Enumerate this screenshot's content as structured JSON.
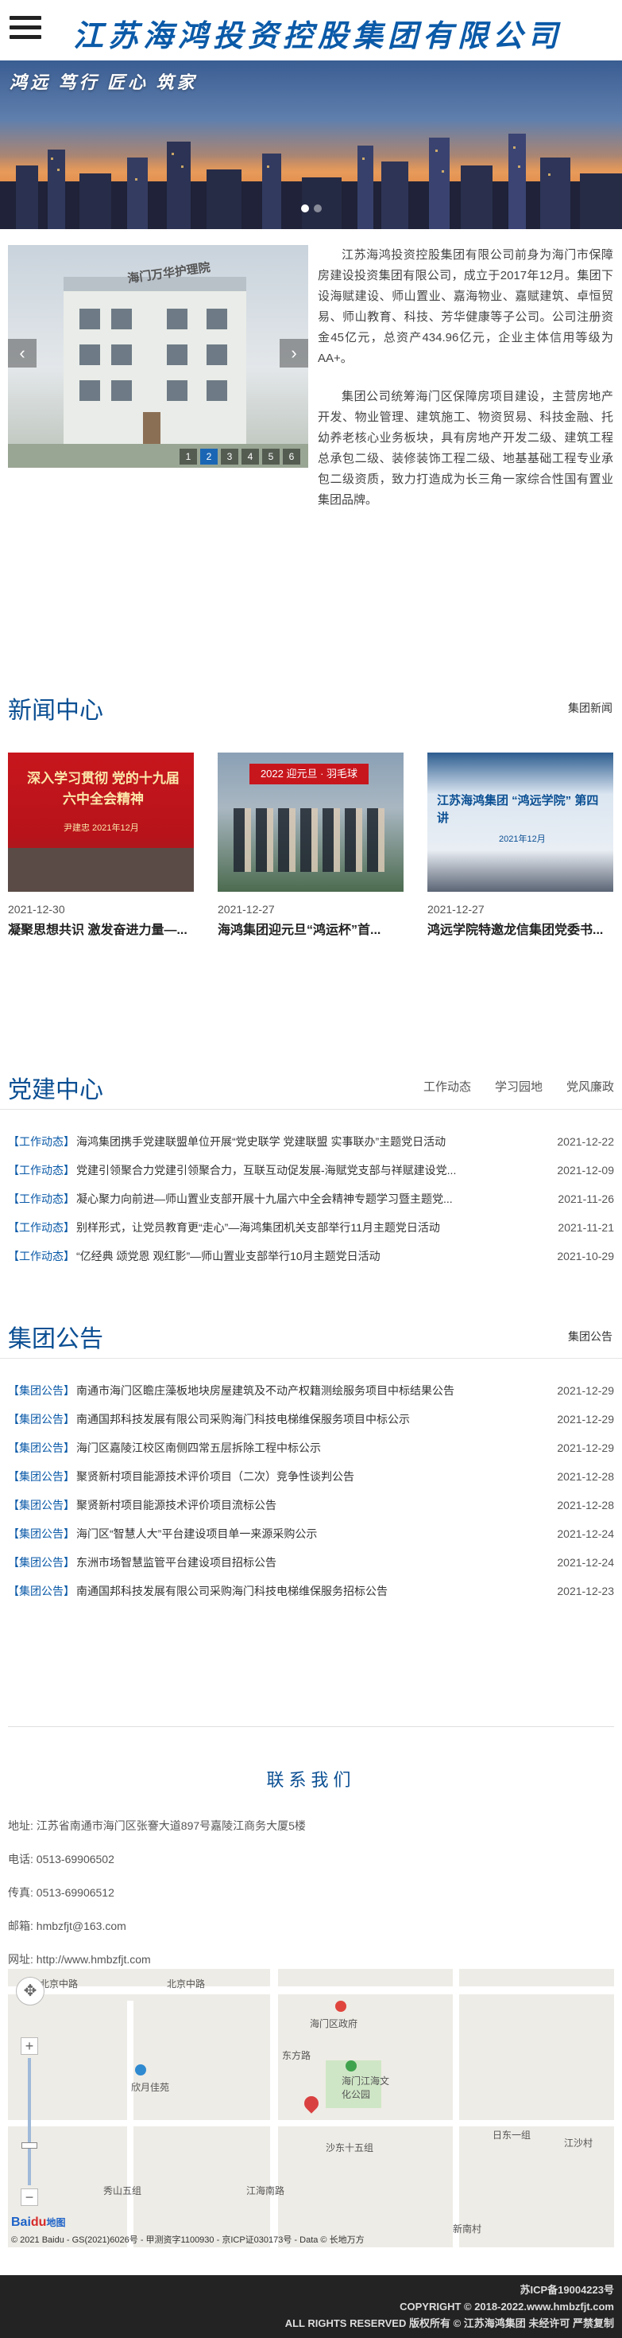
{
  "header": {
    "title": "江苏海鸿投资控股集团有限公司",
    "menu_icon": "menu-icon"
  },
  "banner": {
    "slogan": "鸿远 笃行 匠心 筑家",
    "dots": 2,
    "active_dot": 0
  },
  "about": {
    "slide_label": "海门万华护理院",
    "pager": [
      "1",
      "2",
      "3",
      "4",
      "5",
      "6"
    ],
    "active_page": 1,
    "prev_icon": "chevron-left-icon",
    "next_icon": "chevron-right-icon",
    "paragraphs": [
      "江苏海鸿投资控股集团有限公司前身为海门市保障房建设投资集团有限公司，成立于2017年12月。集团下设海赋建设、师山置业、嘉海物业、嘉赋建筑、卓恒贸易、师山教育、科技、芳华健康等子公司。公司注册资金45亿元，总资产434.96亿元，企业主体信用等级为AA+。",
      "集团公司统筹海门区保障房项目建设，主营房地产开发、物业管理、建筑施工、物资贸易、科技金融、托幼养老核心业务板块，具有房地产开发二级、建筑工程总承包二级、装修装饰工程二级、地基基础工程专业承包二级资质，致力打造成为长三角一家综合性国有置业集团品牌。"
    ]
  },
  "news": {
    "title": "新闻中心",
    "more": "集团新闻",
    "items": [
      {
        "date": "2021-12-30",
        "title": "凝聚思想共识 激发奋进力量—...",
        "thumb_text": "深入学习贯彻 党的十九届六中全会精神",
        "thumb_sub": "尹建忠 2021年12月"
      },
      {
        "date": "2021-12-27",
        "title": "海鸿集团迎元旦“鸿运杯”首...",
        "thumb_text": "2022 迎元旦 · 羽毛球"
      },
      {
        "date": "2021-12-27",
        "title": "鸿远学院特邀龙信集团党委书...",
        "thumb_text": "江苏海鸿集团 “鸿远学院” 第四讲",
        "thumb_sub": "2021年12月"
      }
    ]
  },
  "party": {
    "title": "党建中心",
    "tabs": [
      "工作动态",
      "学习园地",
      "党风廉政"
    ],
    "items": [
      {
        "cat": "【工作动态】",
        "text": "海鸿集团携手党建联盟单位开展“党史联学 党建联盟 实事联办”主题党日活动",
        "date": "2021-12-22"
      },
      {
        "cat": "【工作动态】",
        "text": "党建引领聚合力党建引领聚合力，互联互动促发展-海赋党支部与祥赋建设党...",
        "date": "2021-12-09"
      },
      {
        "cat": "【工作动态】",
        "text": "凝心聚力向前进—师山置业支部开展十九届六中全会精神专题学习暨主题党...",
        "date": "2021-11-26"
      },
      {
        "cat": "【工作动态】",
        "text": "别样形式，让党员教育更“走心”—海鸿集团机关支部举行11月主题党日活动",
        "date": "2021-11-21"
      },
      {
        "cat": "【工作动态】",
        "text": "“亿经典 颂党恩 观红影”—师山置业支部举行10月主题党日活动",
        "date": "2021-10-29"
      }
    ]
  },
  "notice": {
    "title": "集团公告",
    "more": "集团公告",
    "items": [
      {
        "cat": "【集团公告】",
        "text": "南通市海门区瞻庄藻板地块房屋建筑及不动产权籍测绘服务项目中标结果公告",
        "date": "2021-12-29"
      },
      {
        "cat": "【集团公告】",
        "text": "南通国邦科技发展有限公司采购海门科技电梯维保服务项目中标公示",
        "date": "2021-12-29"
      },
      {
        "cat": "【集团公告】",
        "text": "海门区嘉陵江校区南侧四常五层拆除工程中标公示",
        "date": "2021-12-29"
      },
      {
        "cat": "【集团公告】",
        "text": "聚贤新村项目能源技术评价项目（二次）竞争性谈判公告",
        "date": "2021-12-28"
      },
      {
        "cat": "【集团公告】",
        "text": "聚贤新村项目能源技术评价项目流标公告",
        "date": "2021-12-28"
      },
      {
        "cat": "【集团公告】",
        "text": "海门区“智慧人大”平台建设项目单一来源采购公示",
        "date": "2021-12-24"
      },
      {
        "cat": "【集团公告】",
        "text": "东洲市场智慧监管平台建设项目招标公告",
        "date": "2021-12-24"
      },
      {
        "cat": "【集团公告】",
        "text": "南通国邦科技发展有限公司采购海门科技电梯维保服务招标公告",
        "date": "2021-12-23"
      }
    ]
  },
  "contact": {
    "title": "联系我们",
    "address": "地址: 江苏省南通市海门区张謇大道897号嘉陵江商务大厦5楼",
    "phone": "电话: 0513-69906502",
    "fax": "传真: 0513-69906512",
    "email": "邮箱: hmbzfjt@163.com",
    "website": "网址: http://www.hmbzfjt.com"
  },
  "map": {
    "labels": [
      "北京中路",
      "北京中路",
      "海门区政府",
      "海门江海文化公园",
      "欣月佳苑",
      "沙东十五组",
      "江海南路",
      "秀山五组",
      "日东一组",
      "江沙村",
      "新南村",
      "东方路"
    ],
    "copyright": "© 2021 Baidu - GS(2021)6026号 - 甲测资字1100930 - 京ICP证030173号 - Data © 长地万方",
    "logo_text": "Bai",
    "logo_red": "du",
    "logo_suffix": "地图"
  },
  "footer": {
    "icp": "苏ICP备19004223号",
    "copyright": "COPYRIGHT © 2018-2022.www.hmbzfjt.com",
    "rights": "ALL RIGHTS RESERVED 版权所有 © 江苏海鸿集团 未经许可 严禁复制"
  }
}
